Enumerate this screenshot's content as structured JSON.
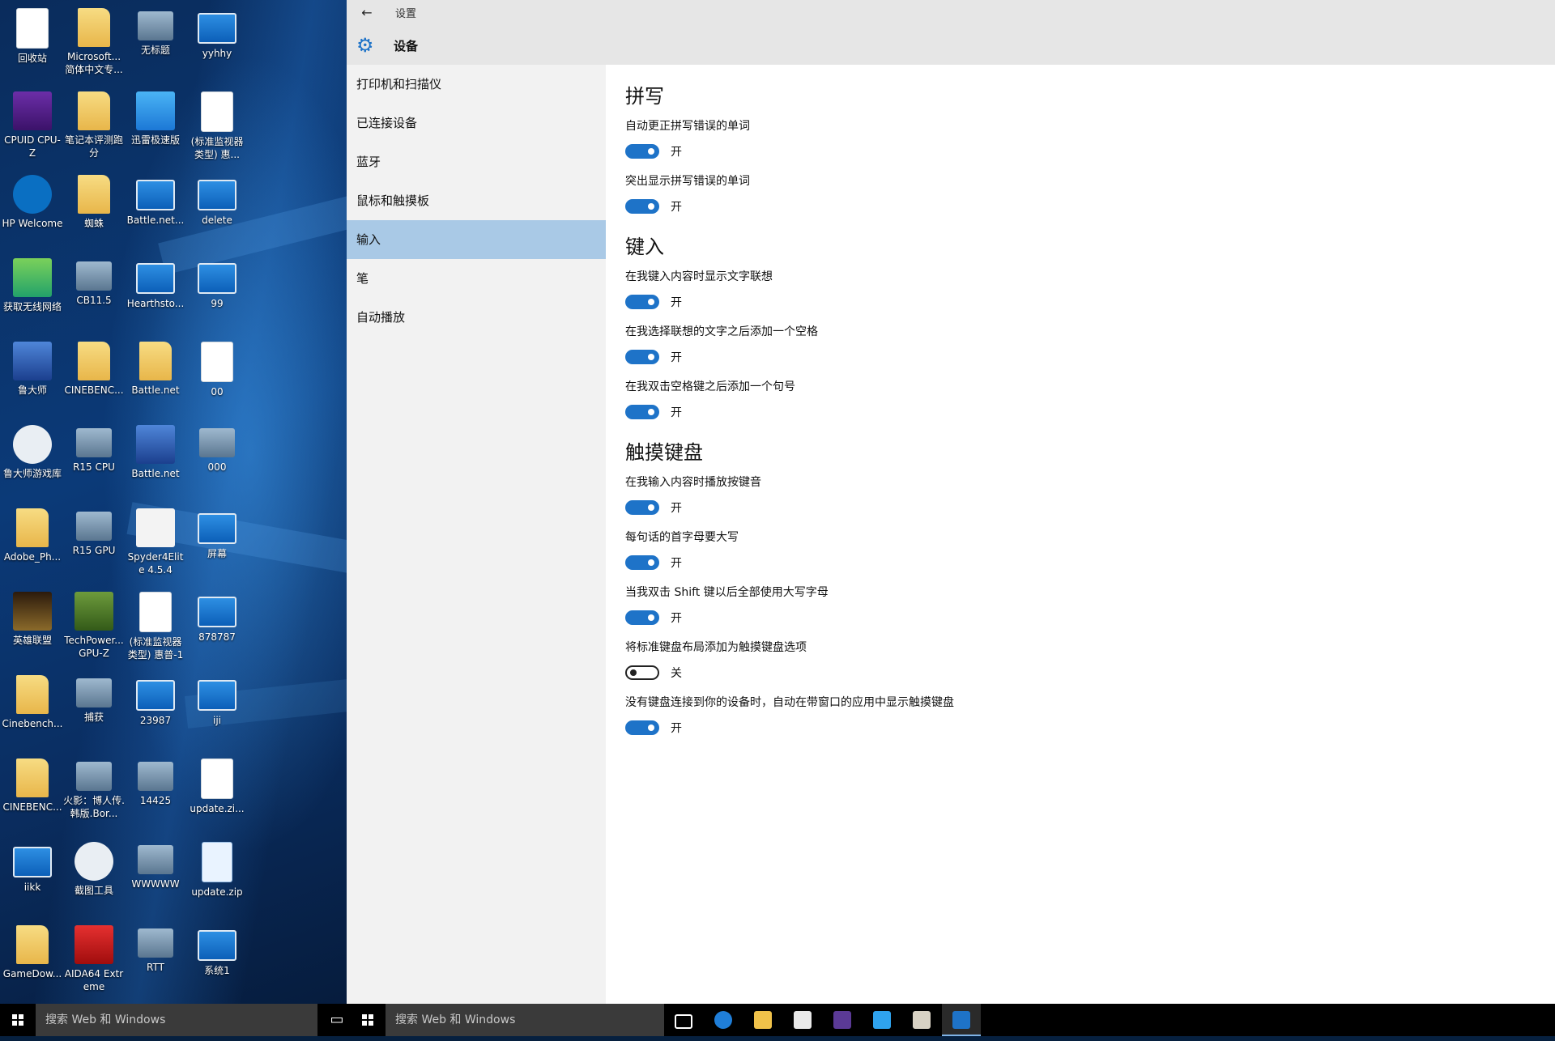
{
  "desktop": {
    "icons": [
      {
        "label": "回收站",
        "kind": "recycle-bin-icon"
      },
      {
        "label": "Microsoft... 简体中文专...",
        "kind": "folder-icon"
      },
      {
        "label": "无标题",
        "kind": "screenshot-icon"
      },
      {
        "label": "yyhhy",
        "kind": "window-icon"
      },
      {
        "label": "CPUID CPU-Z",
        "kind": "cpuz-icon"
      },
      {
        "label": "笔记本评测跑分",
        "kind": "folder-icon"
      },
      {
        "label": "迅雷极速版",
        "kind": "xunlei-icon"
      },
      {
        "label": "(标准监视器类型) 惠...",
        "kind": "document-icon"
      },
      {
        "label": "HP Welcome",
        "kind": "hp-icon"
      },
      {
        "label": "蜘蛛",
        "kind": "folder-icon"
      },
      {
        "label": "Battle.net...",
        "kind": "window-icon"
      },
      {
        "label": "delete",
        "kind": "window-icon"
      },
      {
        "label": "获取无线网络",
        "kind": "wireless-icon"
      },
      {
        "label": "CB11.5",
        "kind": "screenshot-icon"
      },
      {
        "label": "Hearthsto...",
        "kind": "window-icon"
      },
      {
        "label": "99",
        "kind": "window-icon"
      },
      {
        "label": "鲁大师",
        "kind": "ludashi-icon"
      },
      {
        "label": "CINEBENC...",
        "kind": "zip-folder-icon"
      },
      {
        "label": "Battle.net",
        "kind": "folder-icon"
      },
      {
        "label": "00",
        "kind": "document-icon"
      },
      {
        "label": "鲁大师游戏库",
        "kind": "gamepad-icon"
      },
      {
        "label": "R15 CPU",
        "kind": "screenshot-icon"
      },
      {
        "label": "Battle.net",
        "kind": "battlenet-icon"
      },
      {
        "label": "000",
        "kind": "screenshot-icon"
      },
      {
        "label": "Adobe_Ph...",
        "kind": "zip-folder-icon"
      },
      {
        "label": "R15 GPU",
        "kind": "screenshot-icon"
      },
      {
        "label": "Spyder4Elite 4.5.4",
        "kind": "spyder-icon"
      },
      {
        "label": "屏幕",
        "kind": "window-icon"
      },
      {
        "label": "英雄联盟",
        "kind": "lol-icon"
      },
      {
        "label": "TechPower... GPU-Z",
        "kind": "gpuz-icon"
      },
      {
        "label": "(标准监视器类型) 惠普-1",
        "kind": "document-icon"
      },
      {
        "label": "878787",
        "kind": "window-icon"
      },
      {
        "label": "Cinebench...",
        "kind": "folder-icon"
      },
      {
        "label": "捕获",
        "kind": "screenshot-icon"
      },
      {
        "label": "23987",
        "kind": "window-icon"
      },
      {
        "label": "iji",
        "kind": "window-icon"
      },
      {
        "label": "CINEBENC...",
        "kind": "folder-icon"
      },
      {
        "label": "火影：博人传.韩版.Bor...",
        "kind": "screenshot-icon"
      },
      {
        "label": "14425",
        "kind": "screenshot-icon"
      },
      {
        "label": "update.zi...",
        "kind": "document-icon"
      },
      {
        "label": "iikk",
        "kind": "window-icon"
      },
      {
        "label": "截图工具",
        "kind": "snipping-tool-icon"
      },
      {
        "label": "WWWWW",
        "kind": "screenshot-icon"
      },
      {
        "label": "update.zip",
        "kind": "temp-file-icon"
      },
      {
        "label": "GameDow...",
        "kind": "folder-icon"
      },
      {
        "label": "AIDA64 Extreme",
        "kind": "aida64-icon"
      },
      {
        "label": "RTT",
        "kind": "screenshot-icon"
      },
      {
        "label": "系统1",
        "kind": "window-icon"
      }
    ]
  },
  "window": {
    "app_title": "设置",
    "page_title": "设备"
  },
  "sidebar": {
    "items": [
      {
        "label": "打印机和扫描仪"
      },
      {
        "label": "已连接设备"
      },
      {
        "label": "蓝牙"
      },
      {
        "label": "鼠标和触摸板"
      },
      {
        "label": "输入",
        "active": true
      },
      {
        "label": "笔"
      },
      {
        "label": "自动播放"
      }
    ]
  },
  "content": {
    "sections": [
      {
        "title": "拼写",
        "settings": [
          {
            "label": "自动更正拼写错误的单词",
            "state": "开",
            "on": true
          },
          {
            "label": "突出显示拼写错误的单词",
            "state": "开",
            "on": true
          }
        ]
      },
      {
        "title": "键入",
        "settings": [
          {
            "label": "在我键入内容时显示文字联想",
            "state": "开",
            "on": true
          },
          {
            "label": "在我选择联想的文字之后添加一个空格",
            "state": "开",
            "on": true
          },
          {
            "label": "在我双击空格键之后添加一个句号",
            "state": "开",
            "on": true
          }
        ]
      },
      {
        "title": "触摸键盘",
        "settings": [
          {
            "label": "在我输入内容时播放按键音",
            "state": "开",
            "on": true
          },
          {
            "label": "每句话的首字母要大写",
            "state": "开",
            "on": true
          },
          {
            "label": "当我双击 Shift 键以后全部使用大写字母",
            "state": "开",
            "on": true
          },
          {
            "label": "将标准键盘布局添加为触摸键盘选项",
            "state": "关",
            "on": false
          },
          {
            "label": "没有键盘连接到你的设备时，自动在带窗口的应用中显示触摸键盘",
            "state": "开",
            "on": true
          }
        ]
      }
    ]
  },
  "taskbar": {
    "search_placeholder_1": "搜索 Web 和 Windows",
    "search_placeholder_2": "搜索 Web 和 Windows",
    "pinned": [
      {
        "name": "task-view-icon"
      },
      {
        "name": "edge-icon"
      },
      {
        "name": "file-explorer-icon"
      },
      {
        "name": "store-icon"
      },
      {
        "name": "cpuz-icon"
      },
      {
        "name": "xunlei-icon"
      },
      {
        "name": "paint-icon"
      },
      {
        "name": "settings-icon",
        "active": true
      }
    ]
  },
  "colors": {
    "accent": "#1e73c8",
    "nav_active": "#a9c9e6",
    "titlebar": "#e6e6e6",
    "sidebar": "#f2f2f2"
  }
}
